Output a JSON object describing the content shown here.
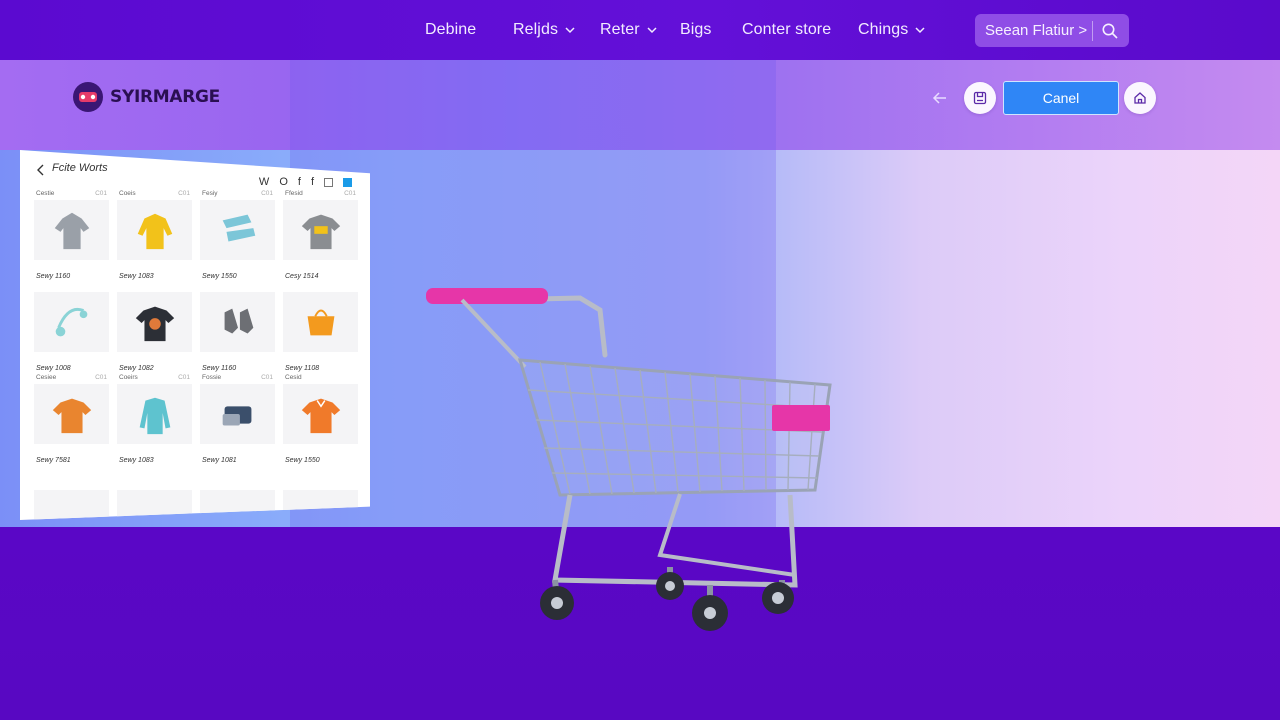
{
  "nav": {
    "items": [
      {
        "label": "Debine",
        "has_dropdown": false
      },
      {
        "label": "Reljds",
        "has_dropdown": true
      },
      {
        "label": "Reter",
        "has_dropdown": true
      },
      {
        "label": "Bigs",
        "has_dropdown": false
      },
      {
        "label": "Conter store",
        "has_dropdown": false
      },
      {
        "label": "Chings",
        "has_dropdown": true
      }
    ],
    "search_label": "Seean Flatiur >",
    "search_icon": "search-icon"
  },
  "header": {
    "brand": "SYIRMARGE",
    "cancel_label": "Canel",
    "icons": [
      "back-arrow-icon",
      "save-icon",
      "home-icon"
    ]
  },
  "catalog": {
    "title": "Fcite Worts",
    "tools": [
      "W",
      "O",
      "f",
      "f"
    ],
    "products": [
      {
        "tag": "Cestie",
        "num": "C01",
        "caption": "Sewy 1160",
        "icon": "hoodie-icon",
        "color": "#9aa0a8"
      },
      {
        "tag": "Coeis",
        "num": "C01",
        "caption": "Sewy 1083",
        "icon": "sweater-icon",
        "color": "#f2c21a"
      },
      {
        "tag": "Fesiy",
        "num": "C01",
        "caption": "Sewy 1550",
        "icon": "scarf-icon",
        "color": "#7cc6d8"
      },
      {
        "tag": "Ffesid",
        "num": "C01",
        "caption": "Cesy 1514",
        "icon": "tshirt-icon",
        "color": "#8a8d91"
      },
      {
        "tag": "",
        "num": "",
        "caption": "Sewy 1008",
        "icon": "earphones-icon",
        "color": "#8ad3d6"
      },
      {
        "tag": "",
        "num": "",
        "caption": "Sewy 1082",
        "icon": "graphic-tee-icon",
        "color": "#2c2f36"
      },
      {
        "tag": "",
        "num": "",
        "caption": "Sewy 1160",
        "icon": "shoes-icon",
        "color": "#6d6f74"
      },
      {
        "tag": "",
        "num": "",
        "caption": "Sewy 1108",
        "icon": "handbag-icon",
        "color": "#f39a1e"
      },
      {
        "tag": "Cesiee",
        "num": "C01",
        "caption": "Sewy 7581",
        "icon": "orange-tee-icon",
        "color": "#e9852f"
      },
      {
        "tag": "Coeirs",
        "num": "C01",
        "caption": "Sewy 1083",
        "icon": "long-sleeve-icon",
        "color": "#5ec3cf"
      },
      {
        "tag": "Fossie",
        "num": "C01",
        "caption": "Sewy 1081",
        "icon": "wallet-icon",
        "color": "#3b4f6b"
      },
      {
        "tag": "Cesid",
        "num": "",
        "caption": "Sewy 1550",
        "icon": "shirt-icon",
        "color": "#f07a2a"
      }
    ]
  },
  "colors": {
    "brand_purple": "#5a07c6",
    "accent_blue": "#2f86f6",
    "cart_handle": "#e636a8"
  }
}
